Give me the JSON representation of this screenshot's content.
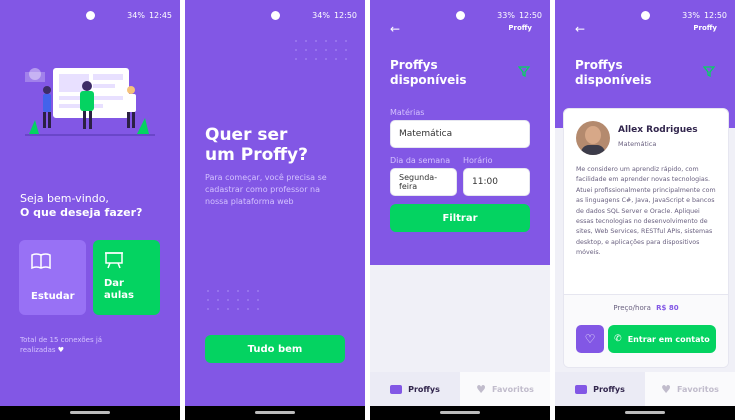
{
  "screen1": {
    "time": "12:45",
    "battery": "34%",
    "welcome_line1": "Seja bem-vindo,",
    "welcome_line2": "O que deseja fazer?",
    "study_label": "Estudar",
    "teach_label": "Dar aulas",
    "connections_text": "Total de 15 conexões já realizadas"
  },
  "screen2": {
    "time": "12:50",
    "battery": "34%",
    "title": "Quer ser um Proffy?",
    "description": "Para começar, você precisa se cadastrar como professor na nossa plataforma web",
    "button_label": "Tudo bem"
  },
  "screen3": {
    "time": "12:50",
    "battery": "33%",
    "logo": "Proffy",
    "title": "Proffys disponíveis",
    "subject_label": "Matérias",
    "subject_value": "Matemática",
    "weekday_label": "Dia da semana",
    "weekday_value": "Segunda-feira",
    "time_label": "Horário",
    "time_value": "11:00",
    "filter_button": "Filtrar",
    "tab_proffys": "Proffys",
    "tab_favorites": "Favoritos"
  },
  "screen4": {
    "time": "12:50",
    "battery": "33%",
    "logo": "Proffy",
    "title": "Proffys disponíveis",
    "teacher_name": "Allex Rodrigues",
    "teacher_subject": "Matemática",
    "bio": "Me considero um aprendiz rápido, com facilidade em aprender novas tecnologias. Atuei profissionalmente principalmente com as linguagens C#, Java, JavaScript e bancos de dados SQL Server e Oracle. Apliquei essas tecnologias no desenvolvimento de sites, Web Services, RESTful APIs, sistemas desktop, e aplicações para dispositivos móveis.",
    "price_label": "Preço/hora",
    "price_value": "R$ 80",
    "contact_button": "Entrar em contato",
    "tab_proffys": "Proffys",
    "tab_favorites": "Favoritos"
  },
  "colors": {
    "primary": "#8257e5",
    "primary_light": "#9871f5",
    "green": "#04d361",
    "text_dark": "#32264d"
  },
  "icons": [
    "book-icon",
    "presentation-icon",
    "heart-icon",
    "filter-icon",
    "back-arrow-icon",
    "whatsapp-icon",
    "tv-icon"
  ]
}
